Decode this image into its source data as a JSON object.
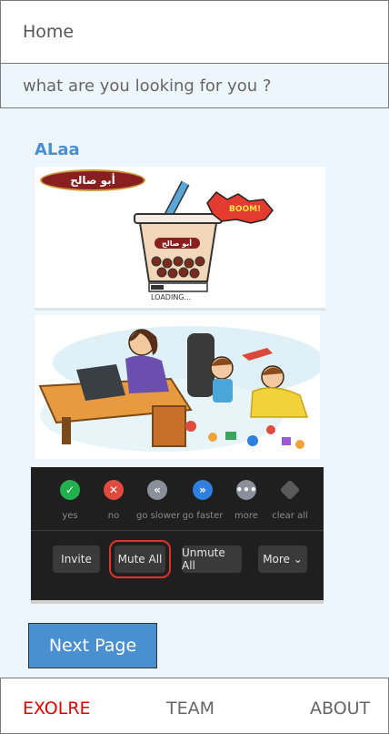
{
  "header": {
    "title": "Home"
  },
  "search": {
    "placeholder": "what are you looking for you ?"
  },
  "post": {
    "username": "ALaa",
    "image1": {
      "logo_text": "أبو صالح",
      "cup_logo_text": "أبو صالح",
      "boom_text": "BOOM!",
      "loading_text": "LOADING..."
    },
    "zoom_controls": {
      "reactions": [
        {
          "label": "yes",
          "icon": "check-icon",
          "color": "#22b14c"
        },
        {
          "label": "no",
          "icon": "cross-icon",
          "color": "#e04b3f"
        },
        {
          "label": "go slower",
          "icon": "double-chevron-left-icon",
          "color": "#8a8f9a"
        },
        {
          "label": "go faster",
          "icon": "double-chevron-right-icon",
          "color": "#2f7fe0"
        },
        {
          "label": "more",
          "icon": "more-dots-icon",
          "color": "#8a8f9a"
        },
        {
          "label": "clear all",
          "icon": "eraser-icon",
          "color": "#8a8f9a"
        }
      ],
      "buttons": {
        "invite": "Invite",
        "mute_all": "Mute All",
        "unmute_all": "Unmute All",
        "more": "More ⌄"
      }
    }
  },
  "next_page": {
    "label": "Next Page"
  },
  "nav": {
    "explore": "EXOLRE",
    "team": "TEAM",
    "about": "ABOUT"
  },
  "colors": {
    "accent": "#4a8fd0",
    "active_nav": "#e00000",
    "background": "#eef6fd"
  }
}
